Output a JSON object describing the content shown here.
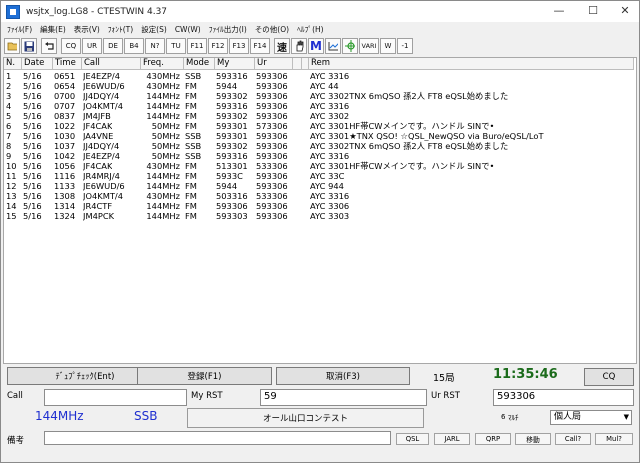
{
  "title": "wsjtx_log.LG8 - CTESTWIN  4.37",
  "window_controls": {
    "minimize": "—",
    "maximize": "☐",
    "close": "✕"
  },
  "menu": [
    "ﾌｧｲﾙ(F)",
    "編集(E)",
    "表示(V)",
    "ﾌｫﾝﾄ(T)",
    "設定(S)",
    "CW(W)",
    "ﾌｧｲﾙ出力(I)",
    "その他(O)",
    "ﾍﾙﾌﾟ(H)"
  ],
  "toolbar": {
    "text_buttons": [
      "CQ",
      "UR",
      "DE",
      "B4",
      "N?",
      "TU",
      "F11",
      "F12",
      "F13",
      "F14"
    ],
    "speed_label": "速",
    "m_label": "M",
    "vari_label": "VARI",
    "w_label": "W",
    "minus1_label": "-1"
  },
  "log": {
    "headers": [
      "N.",
      "Date",
      "Time",
      "Call",
      "Freq.",
      "Mode",
      "My",
      "Ur",
      "",
      "",
      "Rem"
    ],
    "rows": [
      [
        "1",
        "5/16",
        "0651",
        "JE4EZP/4",
        "430MHz",
        "SSB",
        "593316",
        "593306",
        "AYC 3316"
      ],
      [
        "2",
        "5/16",
        "0654",
        "JE6WUD/6",
        "430MHz",
        "FM",
        "5944",
        "593306",
        "AYC 44"
      ],
      [
        "3",
        "5/16",
        "0700",
        "JJ4DQY/4",
        "144MHz",
        "FM",
        "593302",
        "593306",
        "AYC 3302TNX 6mQSO 孫2人 FT8 eQSL始めました"
      ],
      [
        "4",
        "5/16",
        "0707",
        "JO4KMT/4",
        "144MHz",
        "FM",
        "593316",
        "593306",
        "AYC 3316"
      ],
      [
        "5",
        "5/16",
        "0837",
        "JM4JFB",
        "144MHz",
        "FM",
        "593302",
        "593306",
        "AYC 3302"
      ],
      [
        "6",
        "5/16",
        "1022",
        "JF4CAK",
        "50MHz",
        "FM",
        "593301",
        "573306",
        "AYC 3301HF帯CWメインです。ハンドル  SINで•"
      ],
      [
        "7",
        "5/16",
        "1030",
        "JA4VNE",
        "50MHz",
        "SSB",
        "593301",
        "593306",
        "AYC 3301★TNX QSO! ☆QSL_NewQSO via Buro/eQSL/LoT"
      ],
      [
        "8",
        "5/16",
        "1037",
        "JJ4DQY/4",
        "50MHz",
        "SSB",
        "593302",
        "593306",
        "AYC 3302TNX 6mQSO 孫2人 FT8 eQSL始めました"
      ],
      [
        "9",
        "5/16",
        "1042",
        "JE4EZP/4",
        "50MHz",
        "SSB",
        "593316",
        "593306",
        "AYC 3316"
      ],
      [
        "10",
        "5/16",
        "1056",
        "JF4CAK",
        "430MHz",
        "FM",
        "513301",
        "533306",
        "AYC 3301HF帯CWメインです。ハンドル  SINで•"
      ],
      [
        "11",
        "5/16",
        "1116",
        "JR4MRJ/4",
        "144MHz",
        "FM",
        "5933C",
        "593306",
        "AYC 33C"
      ],
      [
        "12",
        "5/16",
        "1133",
        "JE6WUD/6",
        "144MHz",
        "FM",
        "5944",
        "593306",
        "AYC 944"
      ],
      [
        "13",
        "5/16",
        "1308",
        "JO4KMT/4",
        "430MHz",
        "FM",
        "503316",
        "533306",
        "AYC 3316"
      ],
      [
        "14",
        "5/16",
        "1314",
        "JR4CTF",
        "144MHz",
        "FM",
        "593306",
        "593306",
        "AYC 3306"
      ],
      [
        "15",
        "5/16",
        "1324",
        "JM4PCK",
        "144MHz",
        "FM",
        "593303",
        "593306",
        "AYC 3303"
      ]
    ]
  },
  "entry": {
    "dupe_check_button": "ﾃﾞｭﾌﾟﾁｪｯｸ(Ent)",
    "register_button": "登録(F1)",
    "cancel_button": "取消(F3)",
    "station_count": "15局",
    "clock": "11:35:46",
    "cq_button": "CQ",
    "call_label": "Call",
    "call_value": "",
    "my_rst_label": "My RST",
    "my_rst_value": "59",
    "ur_rst_label": "Ur RST",
    "ur_rst_value": "593306",
    "band": "144MHz",
    "mode": "SSB",
    "contest_button": "オール山口コンテスト",
    "multi_label": "ﾏﾙﾁ",
    "multi_prefix": "6",
    "category_value": "個人局",
    "memo_label": "備考",
    "memo_value": "",
    "small_buttons": [
      "QSL",
      "JARL",
      "QRP",
      "移動",
      "Call?",
      "Mul?"
    ]
  },
  "colors": {
    "blue_text": "#1f2fd0",
    "clock_green": "#1b6b1b",
    "accent_blue": "#1e6fd6"
  }
}
